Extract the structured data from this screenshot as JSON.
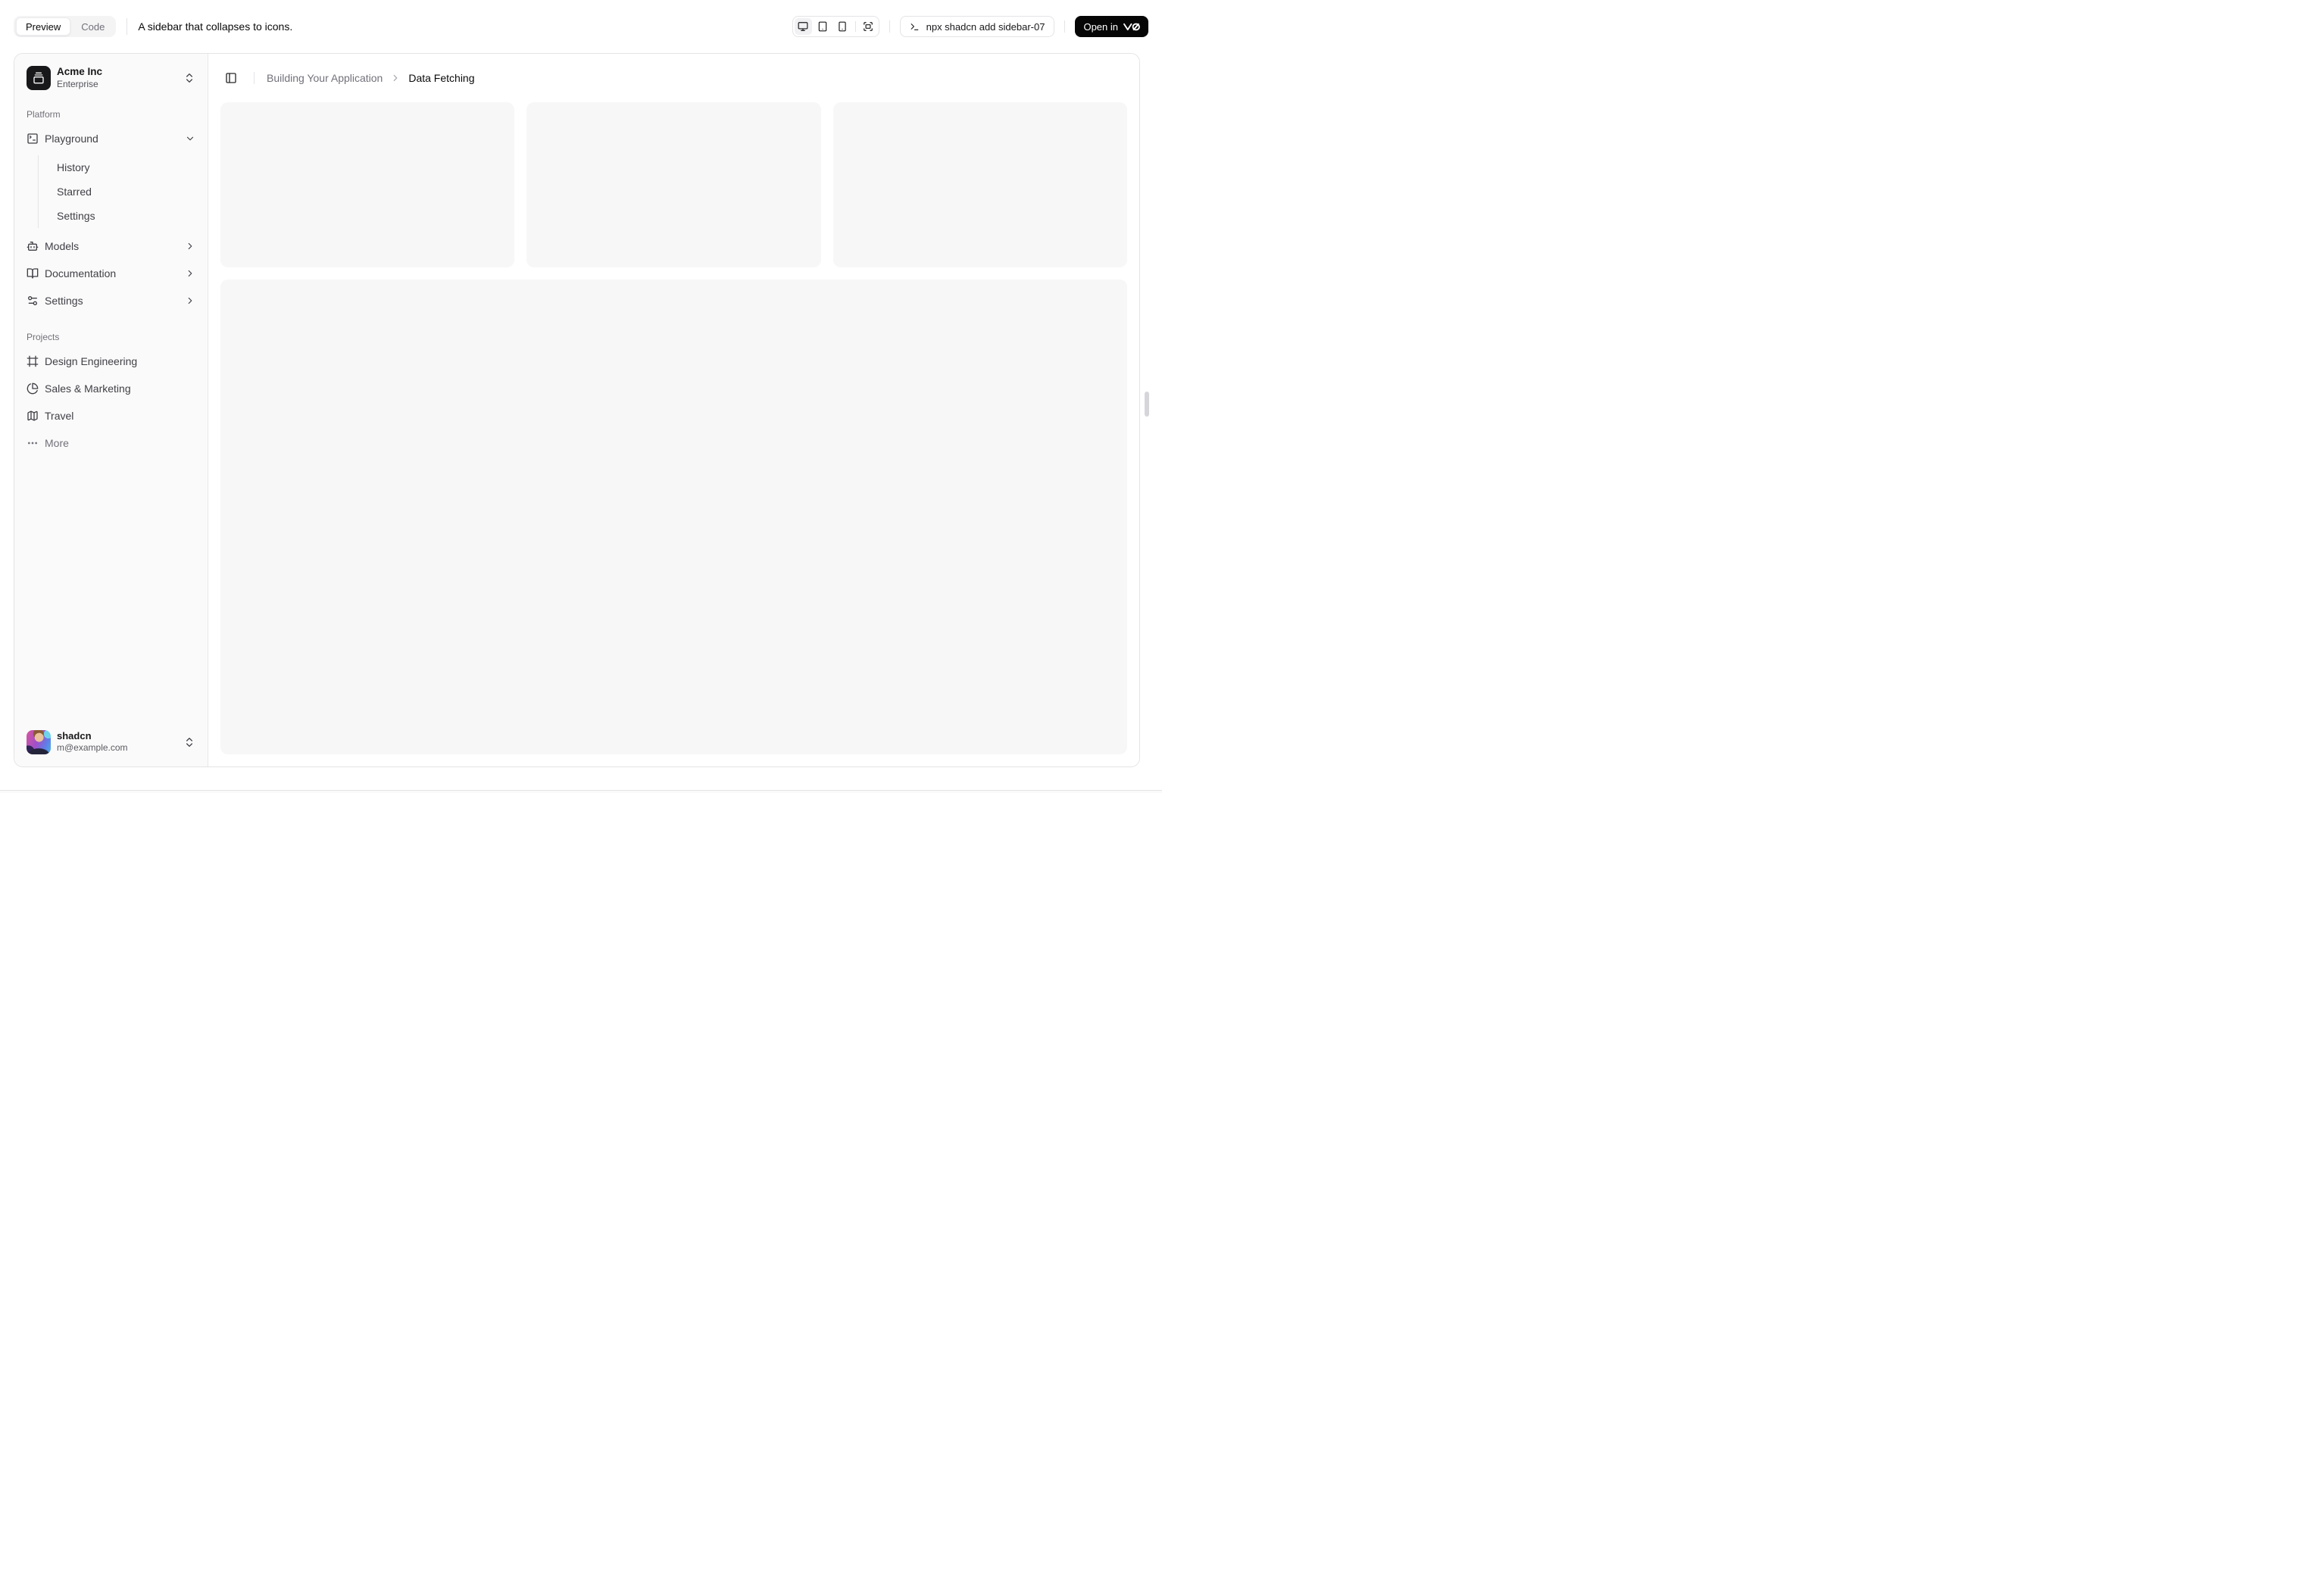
{
  "toolbar": {
    "tab_preview": "Preview",
    "tab_code": "Code",
    "description": "A sidebar that collapses to icons.",
    "command": "npx shadcn add sidebar-07",
    "open_in_label": "Open in"
  },
  "breadcrumb": {
    "parent": "Building Your Application",
    "current": "Data Fetching"
  },
  "sidebar": {
    "team": {
      "name": "Acme Inc",
      "plan": "Enterprise"
    },
    "platform_label": "Platform",
    "platform": [
      {
        "label": "Playground",
        "icon": "square-terminal-icon"
      },
      {
        "label": "Models",
        "icon": "bot-icon"
      },
      {
        "label": "Documentation",
        "icon": "book-open-icon"
      },
      {
        "label": "Settings",
        "icon": "settings-sliders-icon"
      }
    ],
    "playground_sub": [
      "History",
      "Starred",
      "Settings"
    ],
    "projects_label": "Projects",
    "projects": [
      {
        "label": "Design Engineering",
        "icon": "frame-icon"
      },
      {
        "label": "Sales & Marketing",
        "icon": "pie-chart-icon"
      },
      {
        "label": "Travel",
        "icon": "map-icon"
      }
    ],
    "more_label": "More",
    "user": {
      "name": "shadcn",
      "email": "m@example.com"
    }
  },
  "colors": {
    "background": "#ffffff",
    "sidebar_background": "#fafafa",
    "card_background": "#f7f7f8",
    "border": "#e4e4e7",
    "text_primary": "#09090b",
    "text_muted": "#71717a",
    "open_in_button_background": "#060606"
  }
}
